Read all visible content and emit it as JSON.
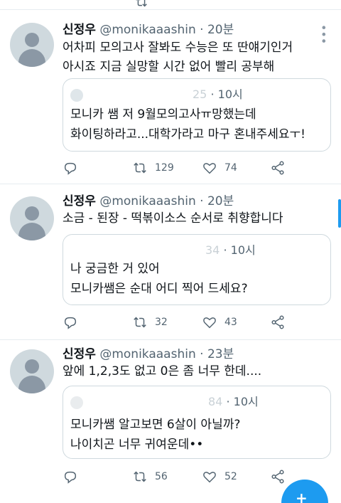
{
  "top_stub": {
    "retweet_count": "",
    "like_count": ""
  },
  "tweets": [
    {
      "name": "신정우",
      "handle": "@monikaaashin",
      "dot": "·",
      "time": "20분",
      "text_lines": [
        "어차피 모의고사 잘봐도 수능은 또 딴얘기인거",
        "아시죠 지금 실망할 시간 없어 빨리 공부해"
      ],
      "quote": {
        "handle_fragment": "25",
        "dot": "·",
        "time": "10시",
        "lines": [
          "모니카 쌤 저 9월모의고사ㅠ망했는데",
          "화이팅하라고...대학가라고 마구 혼내주세요ㅜ!"
        ]
      },
      "retweets": "129",
      "likes": "74"
    },
    {
      "name": "신정우",
      "handle": "@monikaaashin",
      "dot": "·",
      "time": "20분",
      "text_lines": [
        "소금 - 된장 - 떡볶이소스 순서로 취향합니다"
      ],
      "quote": {
        "handle_fragment": "34",
        "dot": "·",
        "time": "10시",
        "lines": [
          "나 궁금한 거 있어",
          "모니카쌤은 순대 어디 찍어 드세요?"
        ]
      },
      "retweets": "32",
      "likes": "43"
    },
    {
      "name": "신정우",
      "handle": "@monikaaashin",
      "dot": "·",
      "time": "23분",
      "text_lines": [
        "앞에 1,2,3도 없고 0은 좀 너무 한데...."
      ],
      "quote": {
        "handle_fragment": "84",
        "dot": "·",
        "time": "10시",
        "lines": [
          "모니카쌤 알고보면 6살이 아닐까?",
          "나이치곤 너무 귀여운데••"
        ]
      },
      "retweets": "56",
      "likes": "52"
    }
  ],
  "colors": {
    "accent": "#1d9bf0",
    "secondary_text": "#536471",
    "border": "#cfd9de"
  },
  "icons": [
    "reply-icon",
    "retweet-icon",
    "like-icon",
    "share-icon",
    "more-icon",
    "compose-icon"
  ]
}
